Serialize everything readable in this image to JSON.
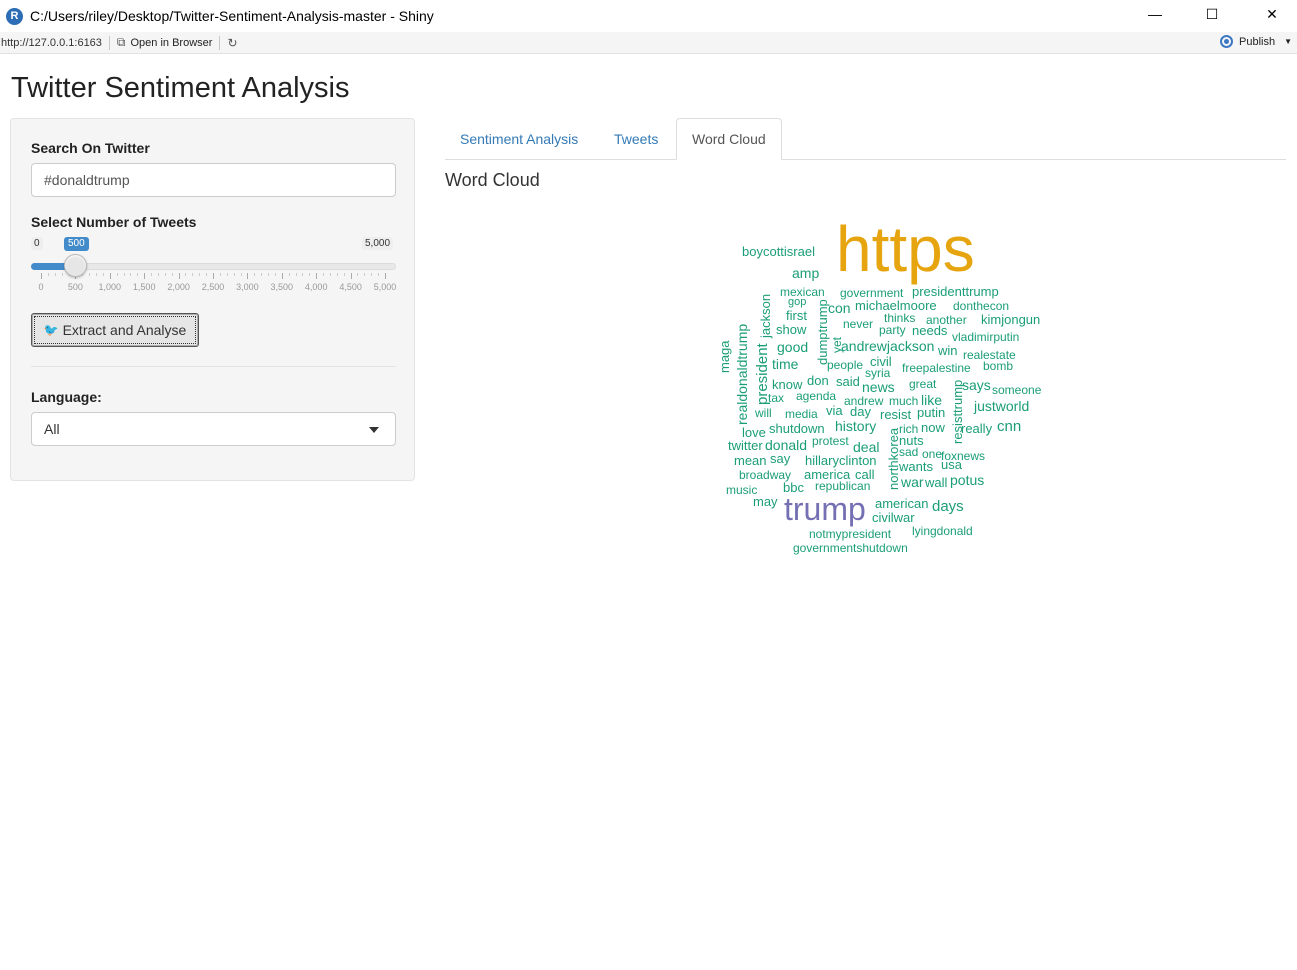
{
  "window": {
    "icon_letter": "R",
    "title": "C:/Users/riley/Desktop/Twitter-Sentiment-Analysis-master - Shiny",
    "minimize": "—",
    "maximize": "☐",
    "close": "✕"
  },
  "toolbar": {
    "url": "http://127.0.0.1:6163",
    "open_in_browser": "Open in Browser",
    "publish": "Publish"
  },
  "app": {
    "title": "Twitter Sentiment Analysis"
  },
  "sidebar": {
    "search_label": "Search On Twitter",
    "search_value": "#donaldtrump",
    "tweets_label": "Select Number of Tweets",
    "slider": {
      "min_label": "0",
      "max_label": "5,000",
      "value_label": "500",
      "value": 500,
      "min": 0,
      "max": 5000,
      "ticks": [
        "0",
        "500",
        "1,000",
        "1,500",
        "2,000",
        "2,500",
        "3,000",
        "3,500",
        "4,000",
        "4,500",
        "5,000"
      ]
    },
    "extract_button": "Extract and Analyse",
    "language_label": "Language:",
    "language_value": "All"
  },
  "tabs": [
    {
      "label": "Sentiment Analysis",
      "active": false
    },
    {
      "label": "Tweets",
      "active": false
    },
    {
      "label": "Word Cloud",
      "active": true
    }
  ],
  "panel": {
    "heading": "Word Cloud"
  },
  "colors": {
    "accent": "#428bca",
    "link": "#337ab7",
    "wc_gold": "#e6a40f",
    "wc_purple": "#7570b3",
    "wc_green": "#1b9e77"
  },
  "word_cloud": [
    {
      "word": "https",
      "color": "gold"
    },
    {
      "word": "trump",
      "color": "purple"
    },
    {
      "word": "boycottisrael",
      "color": "green"
    },
    {
      "word": "amp",
      "color": "green"
    },
    {
      "word": "mexican",
      "color": "green"
    },
    {
      "word": "gop",
      "color": "green"
    },
    {
      "word": "first",
      "color": "green"
    },
    {
      "word": "show",
      "color": "green"
    },
    {
      "word": "good",
      "color": "green"
    },
    {
      "word": "time",
      "color": "green"
    },
    {
      "word": "know",
      "color": "green"
    },
    {
      "word": "tax",
      "color": "green"
    },
    {
      "word": "will",
      "color": "green"
    },
    {
      "word": "love",
      "color": "green"
    },
    {
      "word": "twitter",
      "color": "green"
    },
    {
      "word": "mean",
      "color": "green"
    },
    {
      "word": "broadway",
      "color": "green"
    },
    {
      "word": "music",
      "color": "green"
    },
    {
      "word": "may",
      "color": "green"
    },
    {
      "word": "government",
      "color": "green"
    },
    {
      "word": "presidenttrump",
      "color": "green"
    },
    {
      "word": "con",
      "color": "green"
    },
    {
      "word": "michaelmoore",
      "color": "green"
    },
    {
      "word": "donthecon",
      "color": "green"
    },
    {
      "word": "never",
      "color": "green"
    },
    {
      "word": "thinks",
      "color": "green"
    },
    {
      "word": "another",
      "color": "green"
    },
    {
      "word": "kimjongun",
      "color": "green"
    },
    {
      "word": "party",
      "color": "green"
    },
    {
      "word": "needs",
      "color": "green"
    },
    {
      "word": "vladimirputin",
      "color": "green"
    },
    {
      "word": "andrewjackson",
      "color": "green"
    },
    {
      "word": "win",
      "color": "green"
    },
    {
      "word": "realestate",
      "color": "green"
    },
    {
      "word": "people",
      "color": "green"
    },
    {
      "word": "civil",
      "color": "green"
    },
    {
      "word": "freepalestine",
      "color": "green"
    },
    {
      "word": "bomb",
      "color": "green"
    },
    {
      "word": "syria",
      "color": "green"
    },
    {
      "word": "don",
      "color": "green"
    },
    {
      "word": "said",
      "color": "green"
    },
    {
      "word": "news",
      "color": "green"
    },
    {
      "word": "great",
      "color": "green"
    },
    {
      "word": "says",
      "color": "green"
    },
    {
      "word": "someone",
      "color": "green"
    },
    {
      "word": "agenda",
      "color": "green"
    },
    {
      "word": "andrew",
      "color": "green"
    },
    {
      "word": "much",
      "color": "green"
    },
    {
      "word": "like",
      "color": "green"
    },
    {
      "word": "justworld",
      "color": "green"
    },
    {
      "word": "media",
      "color": "green"
    },
    {
      "word": "via",
      "color": "green"
    },
    {
      "word": "day",
      "color": "green"
    },
    {
      "word": "resist",
      "color": "green"
    },
    {
      "word": "putin",
      "color": "green"
    },
    {
      "word": "shutdown",
      "color": "green"
    },
    {
      "word": "history",
      "color": "green"
    },
    {
      "word": "rich",
      "color": "green"
    },
    {
      "word": "now",
      "color": "green"
    },
    {
      "word": "really",
      "color": "green"
    },
    {
      "word": "cnn",
      "color": "green"
    },
    {
      "word": "donald",
      "color": "green"
    },
    {
      "word": "protest",
      "color": "green"
    },
    {
      "word": "deal",
      "color": "green"
    },
    {
      "word": "nuts",
      "color": "green"
    },
    {
      "word": "say",
      "color": "green"
    },
    {
      "word": "sad",
      "color": "green"
    },
    {
      "word": "one",
      "color": "green"
    },
    {
      "word": "foxnews",
      "color": "green"
    },
    {
      "word": "hillaryclinton",
      "color": "green"
    },
    {
      "word": "wants",
      "color": "green"
    },
    {
      "word": "usa",
      "color": "green"
    },
    {
      "word": "america",
      "color": "green"
    },
    {
      "word": "call",
      "color": "green"
    },
    {
      "word": "bbc",
      "color": "green"
    },
    {
      "word": "republican",
      "color": "green"
    },
    {
      "word": "war",
      "color": "green"
    },
    {
      "word": "wall",
      "color": "green"
    },
    {
      "word": "potus",
      "color": "green"
    },
    {
      "word": "american",
      "color": "green"
    },
    {
      "word": "days",
      "color": "green"
    },
    {
      "word": "civilwar",
      "color": "green"
    },
    {
      "word": "notmypresident",
      "color": "green"
    },
    {
      "word": "lyingdonald",
      "color": "green"
    },
    {
      "word": "governmentshutdown",
      "color": "green"
    },
    {
      "word": "maga",
      "color": "green"
    },
    {
      "word": "realdonaldtrump",
      "color": "green"
    },
    {
      "word": "president",
      "color": "green"
    },
    {
      "word": "jackson",
      "color": "green"
    },
    {
      "word": "dumptrump",
      "color": "green"
    },
    {
      "word": "yet",
      "color": "green"
    },
    {
      "word": "northkorea",
      "color": "green"
    },
    {
      "word": "resisttrump",
      "color": "green"
    }
  ]
}
